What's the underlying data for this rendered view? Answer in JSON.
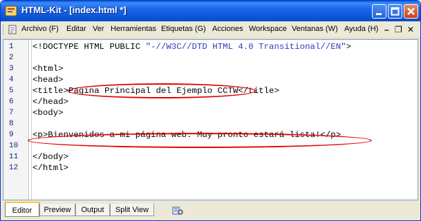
{
  "window": {
    "title": "HTML-Kit - [index.html *]"
  },
  "menu": {
    "items": [
      "Archivo (F)",
      "Editar",
      "Ver",
      "Herramientas",
      "Etiquetas (G)",
      "Acciones",
      "Workspace",
      "Ventanas (W)",
      "Ayuda (H)"
    ],
    "mdi_controls": [
      "–",
      "❐",
      "✕"
    ]
  },
  "editor": {
    "line_numbers": [
      "1",
      "2",
      "3",
      "4",
      "5",
      "6",
      "7",
      "8",
      "9",
      "10",
      "11",
      "12"
    ],
    "lines": [
      {
        "text": "<!DOCTYPE HTML PUBLIC ",
        "string": "\"-//W3C//DTD HTML 4.0 Transitional//EN\"",
        "tail": ">"
      },
      {
        "text": ""
      },
      {
        "text": "<html>"
      },
      {
        "text": "<head>"
      },
      {
        "text": "<title>Pagina Principal del Ejemplo CCTW</title>"
      },
      {
        "text": "</head>"
      },
      {
        "text": "<body>"
      },
      {
        "text": ""
      },
      {
        "text": "<p>Bienvenidos a mi página web. Muy pronto estará lista!</p>"
      },
      {
        "text": ""
      },
      {
        "text": "</body>"
      },
      {
        "text": "</html>"
      }
    ]
  },
  "tabs": [
    "Editor",
    "Preview",
    "Output",
    "Split View"
  ],
  "active_tab": "Editor",
  "colors": {
    "titlebar": "#0854d6",
    "highlight_ellipse": "#e00000",
    "line_number": "#0a248a",
    "string_literal": "#2a3bb8"
  }
}
